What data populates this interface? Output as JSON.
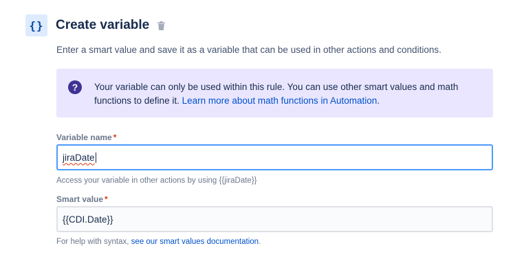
{
  "header": {
    "icon": "curly-braces-icon",
    "icon_glyph": "{}",
    "title": "Create variable",
    "delete_icon": "trash-icon"
  },
  "description": "Enter a smart value and save it as a variable that can be used in other actions and conditions.",
  "info_panel": {
    "icon": "question-icon",
    "icon_glyph": "?",
    "text": "Your variable can only be used within this rule. You can use other smart values and math functions to define it.",
    "link_text": "Learn more about math functions in Automation",
    "trailing": "."
  },
  "variable_name": {
    "label": "Variable name",
    "required_mark": "*",
    "value": "jiraDate",
    "helper": "Access your variable in other actions by using {{jiraDate}}"
  },
  "smart_value": {
    "label": "Smart value",
    "required_mark": "*",
    "value": "{{CDI.Date}}",
    "helper_prefix": "For help with syntax,",
    "helper_link": "see our smart values documentation",
    "helper_suffix": "."
  },
  "colors": {
    "info_bg": "#eae6ff",
    "info_icon": "#403294",
    "link": "#0052cc",
    "focus_border": "#4c9aff",
    "required": "#de350b"
  }
}
